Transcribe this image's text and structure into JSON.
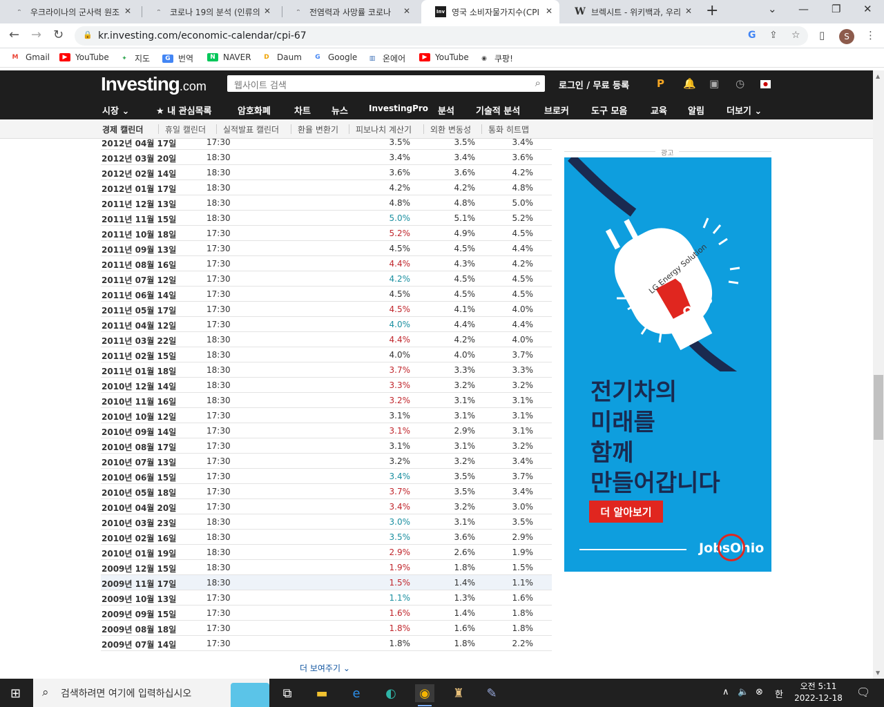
{
  "browser": {
    "tabs": [
      {
        "title": "우크라이나의 군사력 원조",
        "icon": "ᵔ"
      },
      {
        "title": "코로나 19의 분석 (인류의",
        "icon": "ᵔ"
      },
      {
        "title": "전염력과 사망률 코로나",
        "icon": "ᵔ"
      },
      {
        "title": "영국 소비자물가지수(CPI",
        "icon": "Inv"
      },
      {
        "title": "브렉시트 - 위키백과, 우리",
        "icon": "W"
      }
    ],
    "url": "kr.investing.com/economic-calendar/cpi-67",
    "avatar_letter": "S",
    "bookmarks": [
      "Gmail",
      "YouTube",
      "지도",
      "번역",
      "NAVER",
      "Daum",
      "Google",
      "온에어",
      "YouTube",
      "쿠팡!"
    ]
  },
  "site": {
    "logo_main": "Investing",
    "logo_suffix": ".com",
    "search_placeholder": "웹사이트 검색",
    "login": "로그인 / 무료 등록",
    "nav": [
      "시장",
      "내 관심목록",
      "암호화폐",
      "차트",
      "뉴스",
      "InvestingPro",
      "분석",
      "기술적 분석",
      "브로커",
      "도구 모음",
      "교육",
      "알림",
      "더보기"
    ],
    "subnav": [
      "경제 캘린더",
      "휴일 캘린더",
      "실적발표 캘린더",
      "환율 변환기",
      "피보나치 계산기",
      "외환 변동성",
      "통화 히트맵"
    ]
  },
  "table": {
    "rows": [
      {
        "date": "2012년 04월 17일",
        "time": "17:30",
        "actual": "3.5%",
        "forecast": "3.5%",
        "previous": "3.4%",
        "status": "neutral"
      },
      {
        "date": "2012년 03월 20일",
        "time": "18:30",
        "actual": "3.4%",
        "forecast": "3.4%",
        "previous": "3.6%",
        "status": "neutral"
      },
      {
        "date": "2012년 02월 14일",
        "time": "18:30",
        "actual": "3.6%",
        "forecast": "3.6%",
        "previous": "4.2%",
        "status": "neutral"
      },
      {
        "date": "2012년 01월 17일",
        "time": "18:30",
        "actual": "4.2%",
        "forecast": "4.2%",
        "previous": "4.8%",
        "status": "neutral"
      },
      {
        "date": "2011년 12월 13일",
        "time": "18:30",
        "actual": "4.8%",
        "forecast": "4.8%",
        "previous": "5.0%",
        "status": "neutral"
      },
      {
        "date": "2011년 11월 15일",
        "time": "18:30",
        "actual": "5.0%",
        "forecast": "5.1%",
        "previous": "5.2%",
        "status": "better"
      },
      {
        "date": "2011년 10월 18일",
        "time": "17:30",
        "actual": "5.2%",
        "forecast": "4.9%",
        "previous": "4.5%",
        "status": "worse"
      },
      {
        "date": "2011년 09월 13일",
        "time": "17:30",
        "actual": "4.5%",
        "forecast": "4.5%",
        "previous": "4.4%",
        "status": "neutral"
      },
      {
        "date": "2011년 08월 16일",
        "time": "17:30",
        "actual": "4.4%",
        "forecast": "4.3%",
        "previous": "4.2%",
        "status": "worse"
      },
      {
        "date": "2011년 07월 12일",
        "time": "17:30",
        "actual": "4.2%",
        "forecast": "4.5%",
        "previous": "4.5%",
        "status": "better"
      },
      {
        "date": "2011년 06월 14일",
        "time": "17:30",
        "actual": "4.5%",
        "forecast": "4.5%",
        "previous": "4.5%",
        "status": "neutral"
      },
      {
        "date": "2011년 05월 17일",
        "time": "17:30",
        "actual": "4.5%",
        "forecast": "4.1%",
        "previous": "4.0%",
        "status": "worse"
      },
      {
        "date": "2011년 04월 12일",
        "time": "17:30",
        "actual": "4.0%",
        "forecast": "4.4%",
        "previous": "4.4%",
        "status": "better"
      },
      {
        "date": "2011년 03월 22일",
        "time": "18:30",
        "actual": "4.4%",
        "forecast": "4.2%",
        "previous": "4.0%",
        "status": "worse"
      },
      {
        "date": "2011년 02월 15일",
        "time": "18:30",
        "actual": "4.0%",
        "forecast": "4.0%",
        "previous": "3.7%",
        "status": "neutral"
      },
      {
        "date": "2011년 01월 18일",
        "time": "18:30",
        "actual": "3.7%",
        "forecast": "3.3%",
        "previous": "3.3%",
        "status": "worse"
      },
      {
        "date": "2010년 12월 14일",
        "time": "18:30",
        "actual": "3.3%",
        "forecast": "3.2%",
        "previous": "3.2%",
        "status": "worse"
      },
      {
        "date": "2010년 11월 16일",
        "time": "18:30",
        "actual": "3.2%",
        "forecast": "3.1%",
        "previous": "3.1%",
        "status": "worse"
      },
      {
        "date": "2010년 10월 12일",
        "time": "17:30",
        "actual": "3.1%",
        "forecast": "3.1%",
        "previous": "3.1%",
        "status": "neutral"
      },
      {
        "date": "2010년 09월 14일",
        "time": "17:30",
        "actual": "3.1%",
        "forecast": "2.9%",
        "previous": "3.1%",
        "status": "worse"
      },
      {
        "date": "2010년 08월 17일",
        "time": "17:30",
        "actual": "3.1%",
        "forecast": "3.1%",
        "previous": "3.2%",
        "status": "neutral"
      },
      {
        "date": "2010년 07월 13일",
        "time": "17:30",
        "actual": "3.2%",
        "forecast": "3.2%",
        "previous": "3.4%",
        "status": "neutral"
      },
      {
        "date": "2010년 06월 15일",
        "time": "17:30",
        "actual": "3.4%",
        "forecast": "3.5%",
        "previous": "3.7%",
        "status": "better"
      },
      {
        "date": "2010년 05월 18일",
        "time": "17:30",
        "actual": "3.7%",
        "forecast": "3.5%",
        "previous": "3.4%",
        "status": "worse"
      },
      {
        "date": "2010년 04월 20일",
        "time": "17:30",
        "actual": "3.4%",
        "forecast": "3.2%",
        "previous": "3.0%",
        "status": "worse"
      },
      {
        "date": "2010년 03월 23일",
        "time": "18:30",
        "actual": "3.0%",
        "forecast": "3.1%",
        "previous": "3.5%",
        "status": "better"
      },
      {
        "date": "2010년 02월 16일",
        "time": "18:30",
        "actual": "3.5%",
        "forecast": "3.6%",
        "previous": "2.9%",
        "status": "better"
      },
      {
        "date": "2010년 01월 19일",
        "time": "18:30",
        "actual": "2.9%",
        "forecast": "2.6%",
        "previous": "1.9%",
        "status": "worse"
      },
      {
        "date": "2009년 12월 15일",
        "time": "18:30",
        "actual": "1.9%",
        "forecast": "1.8%",
        "previous": "1.5%",
        "status": "worse"
      },
      {
        "date": "2009년 11월 17일",
        "time": "18:30",
        "actual": "1.5%",
        "forecast": "1.4%",
        "previous": "1.1%",
        "status": "worse",
        "highlight": true
      },
      {
        "date": "2009년 10월 13일",
        "time": "17:30",
        "actual": "1.1%",
        "forecast": "1.3%",
        "previous": "1.6%",
        "status": "better"
      },
      {
        "date": "2009년 09월 15일",
        "time": "17:30",
        "actual": "1.6%",
        "forecast": "1.4%",
        "previous": "1.8%",
        "status": "worse"
      },
      {
        "date": "2009년 08월 18일",
        "time": "17:30",
        "actual": "1.8%",
        "forecast": "1.6%",
        "previous": "1.8%",
        "status": "worse"
      },
      {
        "date": "2009년 07월 14일",
        "time": "17:30",
        "actual": "1.8%",
        "forecast": "1.8%",
        "previous": "2.2%",
        "status": "neutral"
      }
    ],
    "show_more": "더 보여주기",
    "colors": {
      "better": "#1a8fa0",
      "worse": "#c0262c",
      "neutral": "#333333"
    }
  },
  "ad": {
    "label": "광고",
    "brand": "LG Energy Solution",
    "state": "Ohio",
    "headline": [
      "전기차의",
      "미래를",
      "함께",
      "만들어갑니다"
    ],
    "cta": "더 알아보기",
    "sponsor": "JobsOhio"
  },
  "taskbar": {
    "search_placeholder": "검색하려면 여기에 입력하십시오",
    "ime": "한",
    "time": "오전 5:11",
    "date": "2022-12-18"
  }
}
